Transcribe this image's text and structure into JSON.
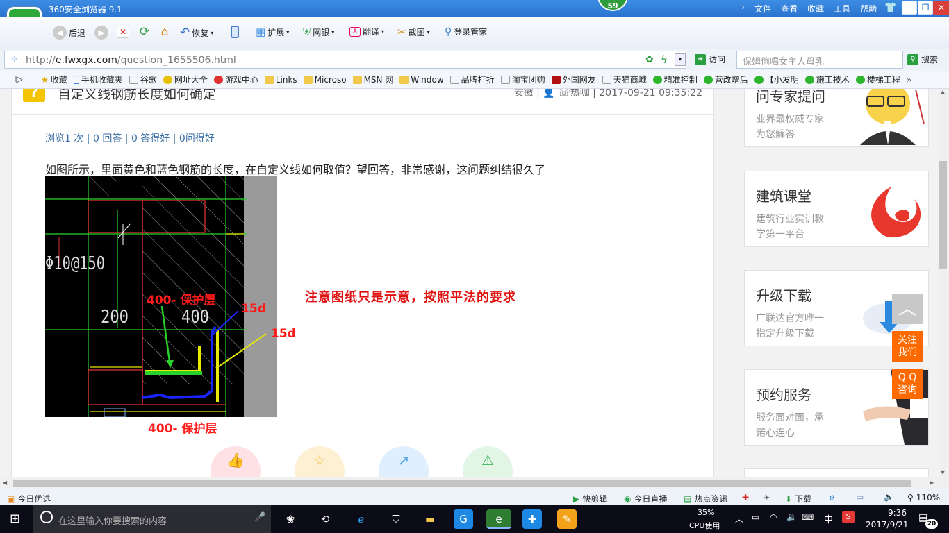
{
  "browser": {
    "title": "360安全浏览器 9.1",
    "badge": "59",
    "menu": [
      "文件",
      "查看",
      "收藏",
      "工具",
      "帮助"
    ],
    "toolbar": {
      "back": "后退",
      "restore": "恢复",
      "extend": "扩展",
      "bank": "网银",
      "translate": "翻译",
      "screenshot": "截图",
      "login": "登录管家"
    },
    "url_domain": "e.fwxgx.com",
    "url_prefix": "http://",
    "url_path": "/question_1655506.html",
    "visit": "访问",
    "search_placeholder": "保姆偷喝女主人母乳",
    "search_button": "搜索"
  },
  "favorites": [
    "收藏",
    "手机收藏夹",
    "谷歌",
    "网址大全",
    "游戏中心",
    "Links",
    "Microso",
    "MSN 网",
    "Window",
    "品牌打折",
    "淘宝团购",
    "外国网友",
    "天猫商城",
    "精准控制",
    "营改增后",
    "【小发明",
    "施工技术",
    "楼梯工程"
  ],
  "question": {
    "title": "自定义线钢筋长度如何确定",
    "meta": "安徽 | 👤 ☏热咖 | 2017-09-21 09:35:22",
    "stats": "浏览1 次 | 0 回答 | 0 答得好 | 0问得好",
    "body": "如图所示，里面黄色和蓝色钢筋的长度，在自定义线如何取值？望回答，非常感谢，这问题纠结很久了",
    "note": "注意图纸只是示意，按照平法的要求",
    "drawing": {
      "label_rebar": "Φ10@150",
      "dim_left": "200",
      "dim_right": "400",
      "ann_top": "400- 保护层",
      "ann_15d_a": "15d",
      "ann_15d_b": "15d",
      "ann_bottom": "400- 保护层"
    }
  },
  "sidebar": [
    {
      "title": "问专家提问",
      "sub1": "业界最权威专家",
      "sub2": "为您解答"
    },
    {
      "title": "建筑课堂",
      "sub1": "建筑行业实训教",
      "sub2": "学第一平台"
    },
    {
      "title": "升级下载",
      "sub1": "广联达官方唯一",
      "sub2": "指定升级下载"
    },
    {
      "title": "预约服务",
      "sub1": "服务面对面，承",
      "sub2": "诺心连心"
    }
  ],
  "float": {
    "follow": "关注 我们",
    "qq": "Q Q 咨询"
  },
  "statusbar": {
    "left": "今日优选",
    "items": [
      "快剪辑",
      "今日直播",
      "热点资讯",
      "下载"
    ],
    "zoom": "110%"
  },
  "taskbar": {
    "search": "在这里输入你要搜索的内容",
    "cpu_pct": "35%",
    "cpu_label": "CPU使用",
    "ime": "中",
    "time": "9:36",
    "date": "2017/9/21",
    "notif": "20"
  }
}
